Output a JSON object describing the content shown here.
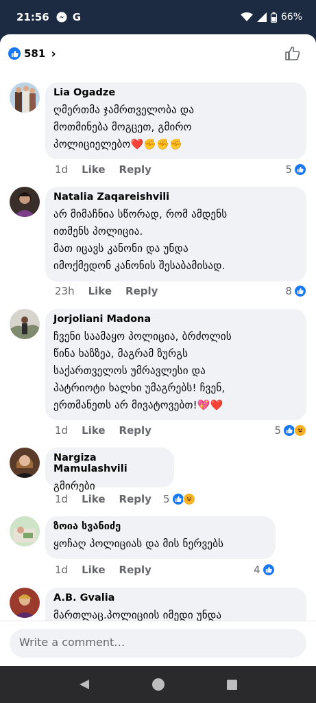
{
  "status": {
    "time": "21:56",
    "battery": "66%"
  },
  "header": {
    "reaction_count": "581",
    "chevron": "›"
  },
  "comments": [
    {
      "name": "Lia Ogadze",
      "text": "ღმერთმა ჯამრთველობა და\nმოთმინება მოგცეთ, გმირო\nპოლიციელებო",
      "emoji": "❤️✊✊✊",
      "time": "1d",
      "like": "Like",
      "reply": "Reply",
      "count": "5"
    },
    {
      "name": "Natalia Zaqareishvili",
      "text": "არ მიმაჩნია სწორად, რომ  ამდენს\nითმენს პოლიცია.\nმათ იცავს კანონი და უნდა\nიმოქმედონ კანონის შესაბამისად.",
      "time": "23h",
      "like": "Like",
      "reply": "Reply",
      "count": "8"
    },
    {
      "name": "Jorjoliani Madona",
      "text": "ჩვენი საამაყო პოლიცია, ბრძოლის\nწინა  ხაზზეა,  მაგრამ ზურგს\nსაქართველოს უმრავლესი და\nპატრიოტი ხალხი უმაგრებს! ჩვენ,\nერთმანეთს არ მივატოვებთ!",
      "emoji": "💖❤️",
      "time": "1d",
      "like": "Like",
      "reply": "Reply",
      "count": "5"
    },
    {
      "name": "Nargiza Mamulashvili",
      "text": "გმირები",
      "time": "1d",
      "like": "Like",
      "reply": "Reply",
      "count": "5"
    },
    {
      "name": "ზოია სვანიძე",
      "text": "ყოჩაღ პოლიციას და მის ნერვებს",
      "time": "1d",
      "like": "Like",
      "reply": "Reply",
      "count": "4"
    },
    {
      "name": "A.B. Gvalia",
      "text": "მართლაც.პოლიციის იმედი უნდა"
    }
  ],
  "composer": {
    "placeholder": "Write a comment…"
  },
  "colors": {
    "accent": "#1877f2",
    "bubble": "#f0f2f5",
    "status_bg": "#1c2b41"
  }
}
